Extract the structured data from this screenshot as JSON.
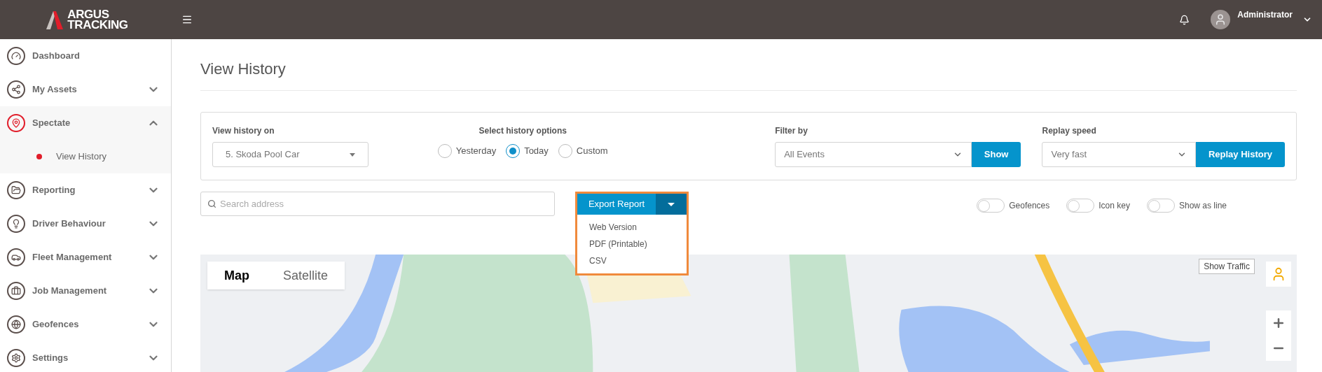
{
  "header": {
    "logo": [
      "ARGUS",
      "TRACKING"
    ],
    "user": "Administrator"
  },
  "sidebar": {
    "items": [
      {
        "label": "Dashboard",
        "kind": "link",
        "selected": false
      },
      {
        "label": "My Assets",
        "kind": "group",
        "selected": false,
        "expanded": false
      },
      {
        "label": "Spectate",
        "kind": "group",
        "selected": true,
        "expanded": true,
        "children": [
          {
            "label": "View History",
            "selected": true
          }
        ]
      },
      {
        "label": "Reporting",
        "kind": "group",
        "selected": false,
        "expanded": false
      },
      {
        "label": "Driver Behaviour",
        "kind": "group",
        "selected": false,
        "expanded": false
      },
      {
        "label": "Fleet Management",
        "kind": "group",
        "selected": false,
        "expanded": false
      },
      {
        "label": "Job Management",
        "kind": "group",
        "selected": false,
        "expanded": false
      },
      {
        "label": "Geofences",
        "kind": "group",
        "selected": false,
        "expanded": false
      },
      {
        "label": "Settings",
        "kind": "group",
        "selected": false,
        "expanded": false
      }
    ]
  },
  "page_title": "View History",
  "filters": {
    "vehicle": {
      "label": "View history on",
      "value": "5. Skoda Pool Car"
    },
    "history_options": {
      "label": "Select history options",
      "options": [
        {
          "label": "Yesterday",
          "selected": false
        },
        {
          "label": "Today",
          "selected": true
        },
        {
          "label": "Custom",
          "selected": false
        }
      ]
    },
    "filter_by": {
      "label": "Filter by",
      "value": "All Events",
      "button": "Show"
    },
    "replay_speed": {
      "label": "Replay speed",
      "value": "Very fast",
      "button": "Replay History"
    }
  },
  "search": {
    "placeholder": "Search address"
  },
  "export": {
    "button": "Export Report",
    "expanded": true,
    "menu": [
      "Web Version",
      "PDF (Printable)",
      "CSV"
    ]
  },
  "toggles": [
    {
      "label": "Geofences",
      "on": false
    },
    {
      "label": "Icon key",
      "on": false
    },
    {
      "label": "Show as line",
      "on": false
    }
  ],
  "map": {
    "types": [
      {
        "label": "Map",
        "selected": true
      },
      {
        "label": "Satellite",
        "selected": false
      }
    ],
    "traffic_button": "Show Traffic"
  }
}
